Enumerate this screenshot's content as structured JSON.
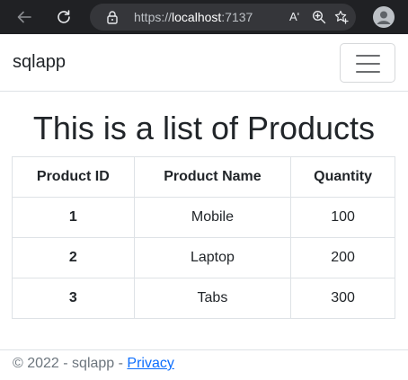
{
  "browser": {
    "url_scheme": "https://",
    "url_host": "localhost",
    "url_port": ":7137",
    "read_aloud_glyph": "Aʹ"
  },
  "navbar": {
    "brand": "sqlapp"
  },
  "main": {
    "title": "This is a list of Products",
    "table": {
      "headers": [
        "Product ID",
        "Product Name",
        "Quantity"
      ],
      "rows": [
        {
          "id": "1",
          "name": "Mobile",
          "quantity": "100"
        },
        {
          "id": "2",
          "name": "Laptop",
          "quantity": "200"
        },
        {
          "id": "3",
          "name": "Tabs",
          "quantity": "300"
        }
      ]
    }
  },
  "footer": {
    "copyright": "© 2022 - sqlapp - ",
    "privacy_link": "Privacy"
  },
  "colors": {
    "chrome_bg": "#202124",
    "address_bg": "#35363a",
    "link": "#0d6efd",
    "footer_text": "#6c757d"
  }
}
